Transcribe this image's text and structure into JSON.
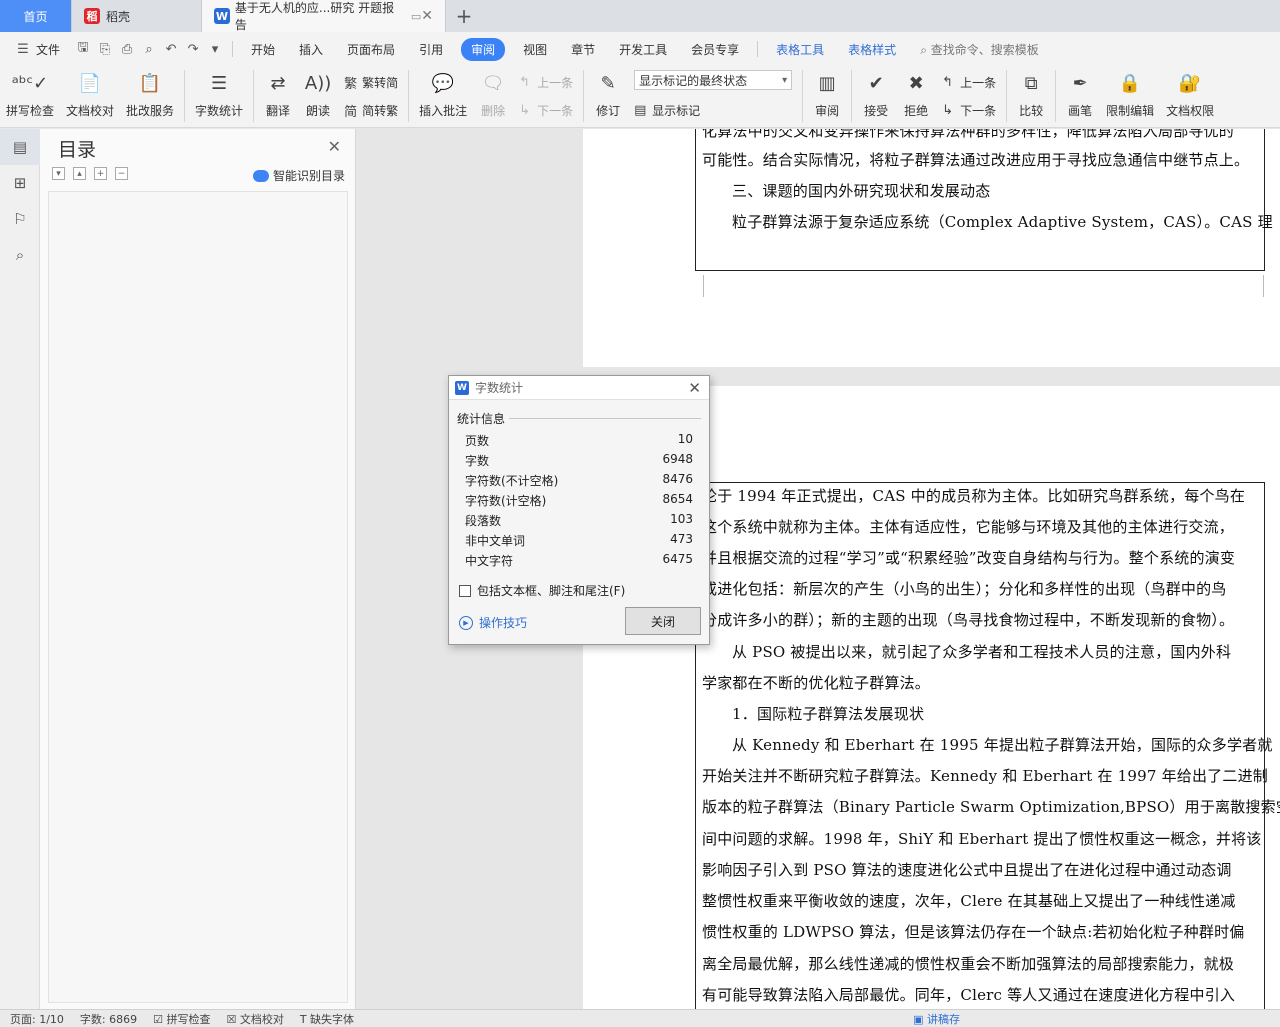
{
  "tabs": {
    "home": "首页",
    "daoke": "稻壳",
    "doc": "基于无人机的应...研究 开题报告"
  },
  "menu": {
    "file": "文件",
    "items": [
      "开始",
      "插入",
      "页面布局",
      "引用",
      "审阅",
      "视图",
      "章节",
      "开发工具",
      "会员专享"
    ],
    "active_index": 4,
    "context_items": [
      "表格工具",
      "表格样式"
    ],
    "search": "查找命令、搜索模板"
  },
  "ribbon": {
    "spell": "拼写检查",
    "proof": "文档校对",
    "revise_service": "批改服务",
    "word_count": "字数统计",
    "translate": "翻译",
    "read": "朗读",
    "trad": "繁转简",
    "simp": "简转繁",
    "insert_comment": "插入批注",
    "delete": "删除",
    "prev": "上一条",
    "next": "下一条",
    "track": "修订",
    "display_state": "显示标记的最终状态",
    "show_markup": "显示标记",
    "review": "审阅",
    "accept": "接受",
    "reject": "拒绝",
    "prev2": "上一条",
    "next2": "下一条",
    "compare": "比较",
    "pen": "画笔",
    "restrict": "限制编辑",
    "doc_perm": "文档权限"
  },
  "toc": {
    "title": "目录",
    "smart": "智能识别目录"
  },
  "document": {
    "page1_lines": [
      "化算法中的交叉和变异操作来保持算法种群的多样性，降低算法陷入局部寻优的",
      "可能性。结合实际情况，将粒子群算法通过改进应用于寻找应急通信中继节点上。",
      "三、课题的国内外研究现状和发展动态",
      "粒子群算法源于复杂适应系统（Complex Adaptive System，CAS）。CAS 理"
    ],
    "page2_lines": [
      "论于 1994 年正式提出，CAS 中的成员称为主体。比如研究鸟群系统，每个鸟在",
      "这个系统中就称为主体。主体有适应性，它能够与环境及其他的主体进行交流，",
      "并且根据交流的过程“学习”或“积累经验”改变自身结构与行为。整个系统的演变",
      "或进化包括：新层次的产生（小鸟的出生）；分化和多样性的出现（鸟群中的鸟",
      "分成许多小的群）；新的主题的出现（鸟寻找食物过程中，不断发现新的食物）。",
      "从 PSO 被提出以来，就引起了众多学者和工程技术人员的注意，国内外科",
      "学家都在不断的优化粒子群算法。",
      "1．国际粒子群算法发展现状",
      "从 Kennedy 和 Eberhart 在 1995 年提出粒子群算法开始，国际的众多学者就",
      "开始关注并不断研究粒子群算法。Kennedy 和 Eberhart 在 1997 年给出了二进制",
      "版本的粒子群算法（Binary Particle Swarm Optimization,BPSO）用于离散搜索空",
      "间中问题的求解。1998 年，ShiY 和 Eberhart 提出了惯性权重这一概念，并将该",
      "影响因子引入到 PSO 算法的速度进化公式中且提出了在进化过程中通过动态调",
      "整惯性权重来平衡收敛的速度，次年，Clere 在其基础上又提出了一种线性递减",
      "惯性权重的 LDWPSO 算法，但是该算法仍存在一个缺点:若初始化粒子种群时偏",
      "离全局最优解，那么线性递减的惯性权重会不断加强算法的局部搜索能力，就极",
      "有可能导致算法陷入局部最优。同年，Clerc 等人又通过在速度进化方程中引入"
    ]
  },
  "dialog": {
    "title": "字数统计",
    "group": "统计信息",
    "rows": [
      {
        "label": "页数",
        "value": "10"
      },
      {
        "label": "字数",
        "value": "6948"
      },
      {
        "label": "字符数(不计空格)",
        "value": "8476"
      },
      {
        "label": "字符数(计空格)",
        "value": "8654"
      },
      {
        "label": "段落数",
        "value": "103"
      },
      {
        "label": "非中文单词",
        "value": "473"
      },
      {
        "label": "中文字符",
        "value": "6475"
      }
    ],
    "checkbox": "包括文本框、脚注和尾注(F)",
    "tips": "操作技巧",
    "close": "关闭"
  },
  "status": {
    "page": "页面: 1/10",
    "words": "字数: 6869",
    "spell": "拼写检查",
    "proof": "文档校对",
    "font_missing": "缺失字体",
    "right": "讲稿存"
  }
}
